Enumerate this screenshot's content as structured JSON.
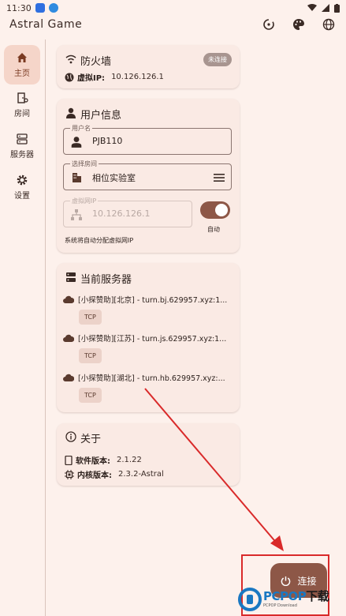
{
  "statusbar": {
    "time": "11:30"
  },
  "app": {
    "title": "Astral Game"
  },
  "nav": {
    "items": [
      {
        "label": "主页",
        "icon": "home-icon"
      },
      {
        "label": "房间",
        "icon": "room-icon"
      },
      {
        "label": "服务器",
        "icon": "server-icon"
      },
      {
        "label": "设置",
        "icon": "settings-icon"
      }
    ]
  },
  "firewall": {
    "title": "防火墙",
    "badge": "未连接",
    "ip_label": "虚拟IP:",
    "ip_value": "10.126.126.1"
  },
  "user": {
    "title": "用户信息",
    "username_label": "用户名",
    "username_value": "PJB110",
    "room_label": "选择房间",
    "room_value": "相位实验室",
    "vip_label": "虚拟网IP",
    "vip_value": "10.126.126.1",
    "auto_label": "自动",
    "hint": "系统将自动分配虚拟网IP"
  },
  "servers": {
    "title": "当前服务器",
    "list": [
      {
        "name": "[小探赞助][北京] - turn.bj.629957.xyz:1...",
        "protocol": "TCP"
      },
      {
        "name": "[小探赞助][江苏] - turn.js.629957.xyz:1...",
        "protocol": "TCP"
      },
      {
        "name": "[小探赞助][湖北] - turn.hb.629957.xyz:...",
        "protocol": "TCP"
      }
    ]
  },
  "about": {
    "title": "关于",
    "software_label": "软件版本:",
    "software_value": "2.1.22",
    "core_label": "内核版本:",
    "core_value": "2.3.2-Astral"
  },
  "fab": {
    "label": "连接"
  },
  "watermark": {
    "main": "PCPOP",
    "main_suffix": "下载",
    "sub": "PCPOP Download"
  },
  "colors": {
    "accent": "#8d5747",
    "background": "#fdf1ec",
    "card": "#faeae4",
    "annotation": "#d92a2a"
  }
}
